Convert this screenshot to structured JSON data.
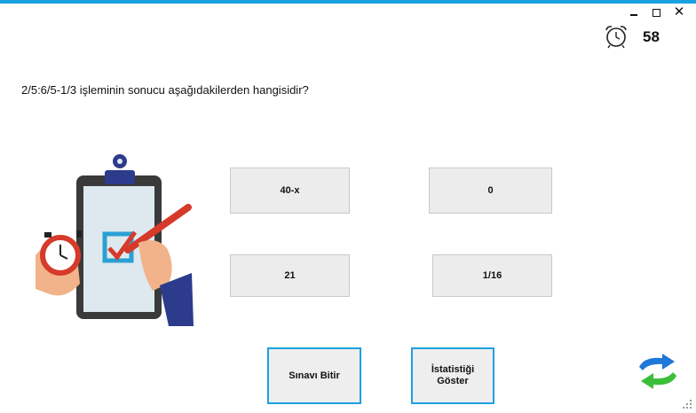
{
  "window": {
    "minimize_glyph": "_",
    "maximize_glyph": "□",
    "close_glyph": "✕"
  },
  "timer": {
    "icon": "alarm-clock-icon",
    "value": "58"
  },
  "question": {
    "text": "2/5:6/5-1/3 işleminin sonucu aşağıdakilerden hangisidir?"
  },
  "illustration": {
    "icon": "clipboard-checklist-stopwatch-icon"
  },
  "answers": [
    {
      "label": "40-x"
    },
    {
      "label": "0"
    },
    {
      "label": "21"
    },
    {
      "label": "1/16"
    }
  ],
  "actions": {
    "finish_label": "Sınavı Bitir",
    "stats_line1": "İstatistiği",
    "stats_line2": "Göster"
  },
  "refresh": {
    "icon": "refresh-arrows-icon"
  },
  "colors": {
    "accent": "#1ba1e2",
    "button_bg": "#ececec"
  }
}
